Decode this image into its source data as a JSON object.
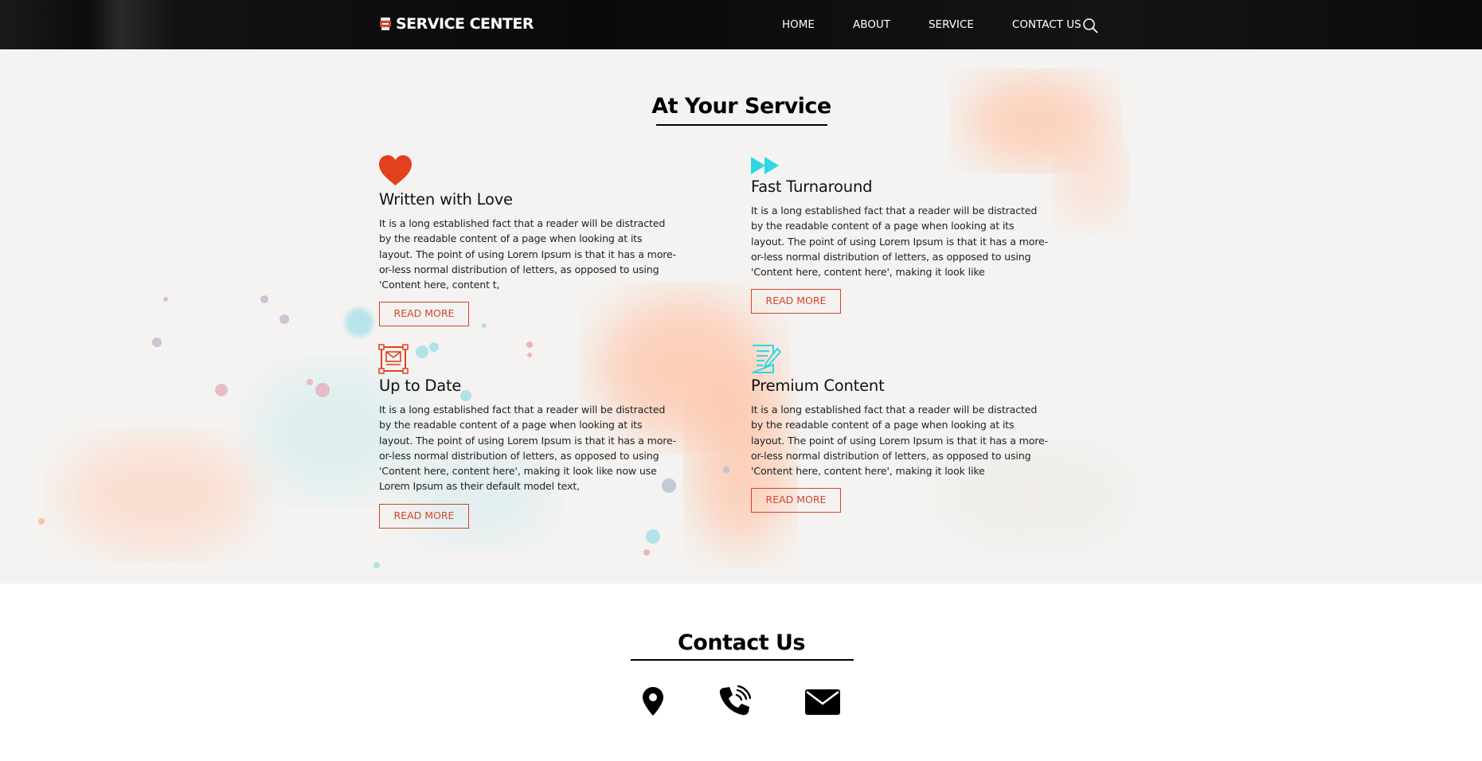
{
  "header": {
    "logo_text": "SERVICE CENTER",
    "nav": [
      "HOME",
      "ABOUT",
      "SERVICE",
      "CONTACT US"
    ],
    "search_icon": "search-icon"
  },
  "service": {
    "title": "At Your Service",
    "cards": [
      {
        "icon": "heart-icon",
        "title": "Written with Love",
        "text": "It is a long established fact that a reader will be distracted by the readable content of a page when looking at its layout. The point of using Lorem Ipsum is that it has a more-or-less normal distribution of letters, as opposed to using 'Content here, content t,",
        "button": "READ MORE"
      },
      {
        "icon": "fast-forward-icon",
        "title": "Fast Turnaround",
        "text": "It is a long established fact that a reader will be distracted by the readable content of a page when looking at its layout. The point of using Lorem Ipsum is that it has a more-or-less normal distribution of letters, as opposed to using 'Content here, content here', making it look like",
        "button": "READ MORE"
      },
      {
        "icon": "newspaper-icon",
        "title": "Up to Date",
        "text": "It is a long established fact that a reader will be distracted by the readable content of a page when looking at its layout. The point of using Lorem Ipsum is that it has a more-or-less normal distribution of letters, as opposed to using 'Content here, content here', making it look like now use Lorem Ipsum as their default model text,",
        "button": "READ MORE"
      },
      {
        "icon": "document-edit-icon",
        "title": "Premium Content",
        "text": "It is a long established fact that a reader will be distracted by the readable content of a page when looking at its layout. The point of using Lorem Ipsum is that it has a more-or-less normal distribution of letters, as opposed to using 'Content here, content here', making it look like",
        "button": "READ MORE"
      }
    ]
  },
  "contact": {
    "title": "Contact Us",
    "icons": [
      "map-pin-icon",
      "phone-icon",
      "envelope-icon"
    ]
  },
  "colors": {
    "accent": "#d6452a",
    "teal": "#2ed8e0",
    "header_bg": "#0c0c0c"
  }
}
